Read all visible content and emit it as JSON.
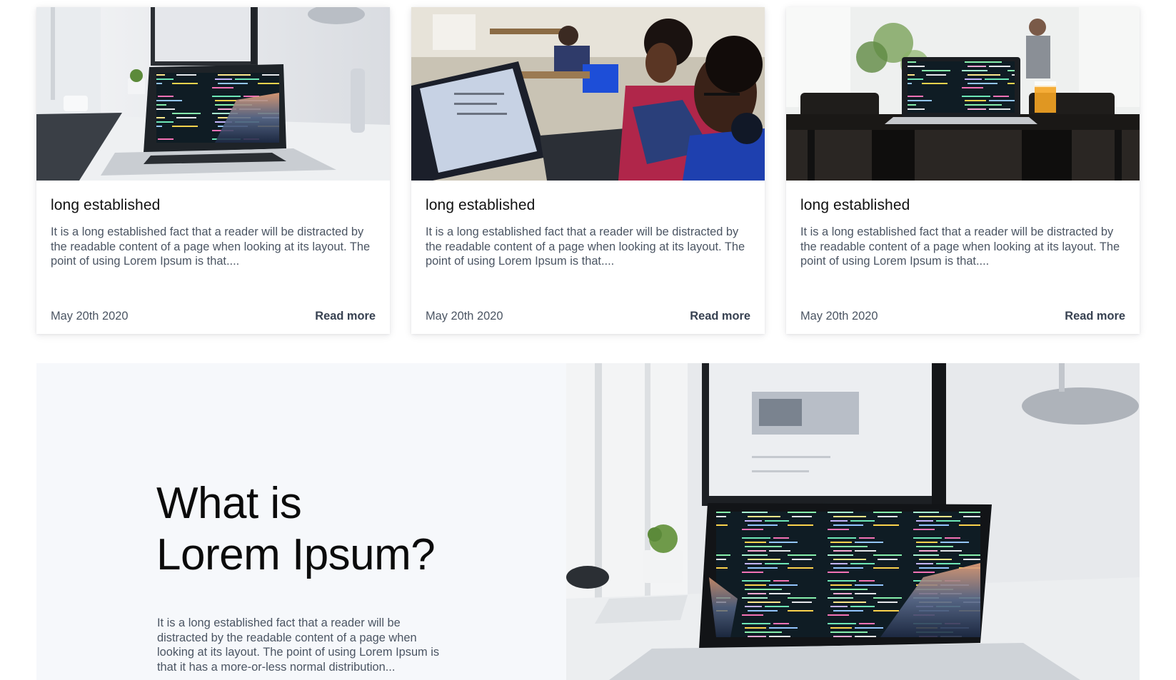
{
  "cards": [
    {
      "image": "laptop-code-desk-photo",
      "title": "long established",
      "excerpt": "It is a long established fact that a reader will be distracted by the readable content of a page when looking at its layout. The point of using Lorem Ipsum is that....",
      "date": "May 20th 2020",
      "link": "Read more"
    },
    {
      "image": "team-working-laptop-photo",
      "title": "long established",
      "excerpt": "It is a long established fact that a reader will be distracted by the readable content of a page when looking at its layout. The point of using Lorem Ipsum is that....",
      "date": "May 20th 2020",
      "link": "Read more"
    },
    {
      "image": "cafe-laptop-photo",
      "title": "long established",
      "excerpt": "It is a long established fact that a reader will be distracted by the readable content of a page when looking at its layout. The point of using Lorem Ipsum is that....",
      "date": "May 20th 2020",
      "link": "Read more"
    }
  ],
  "feature": {
    "title_line1": "What is",
    "title_line2": "Lorem Ipsum?",
    "text": "It is a long established fact that a reader will be distracted by the readable content of a page when looking at its layout. The point of using Lorem Ipsum is that it has a more-or-less normal distribution...",
    "image": "laptop-code-desk-photo"
  },
  "colors": {
    "heading": "#111111",
    "body_text": "#4b5563",
    "link": "#374151",
    "feature_bg": "#f6f8fb"
  }
}
